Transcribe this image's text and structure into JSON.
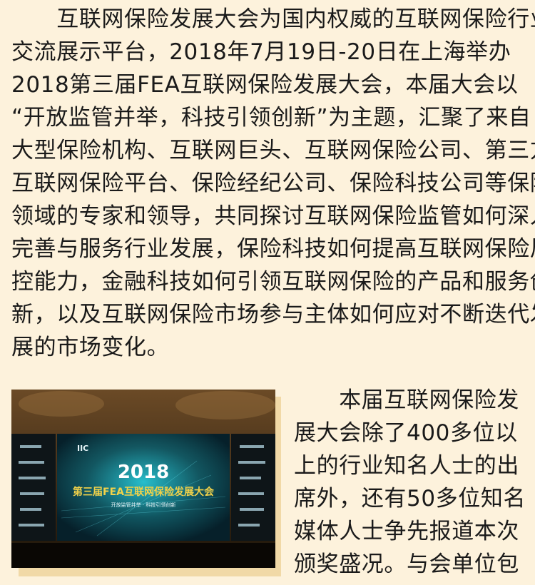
{
  "paragraph1": {
    "lines": [
      "　　互联网保险发展大会为国内权威的互联网保险行业",
      "交流展示平台，2018年7月19日-20日在上海举办",
      "2018第三届FEA互联网保险发展大会，本届大会以",
      "“开放监管并举，科技引领创新”为主题，汇聚了来自",
      "大型保险机构、互联网巨头、互联网保险公司、第三方",
      "互联网保险平台、保险经纪公司、保险科技公司等保险",
      "领域的专家和领导，共同探讨互联网保险监管如何深入",
      "完善与服务行业发展，保险科技如何提高互联网保险风",
      "控能力，金融科技如何引领互联网保险的产品和服务创",
      "新，以及互联网保险市场参与主体如何应对不断迭代发",
      "展的市场变化。"
    ]
  },
  "paragraph2": {
    "lines": [
      "　　本届互联网保险发",
      "展大会除了400多位以",
      "上的行业知名人士的出",
      "席外，还有50多位知名",
      "媒体人士争先报道本次",
      "颁奖盛况。与会单位包"
    ]
  },
  "photo": {
    "logo_text": "IIC",
    "year_text": "2018",
    "title_text": "第三届FEA互联网保险发展大会",
    "slogan_text": "开放监管并举 · 科技引领创新"
  },
  "colors": {
    "background": "#fdf2dc",
    "photo_frame": "#f1d9a7",
    "screen_glow": "#1ec8d8",
    "title_yellow": "#f2d24a"
  }
}
